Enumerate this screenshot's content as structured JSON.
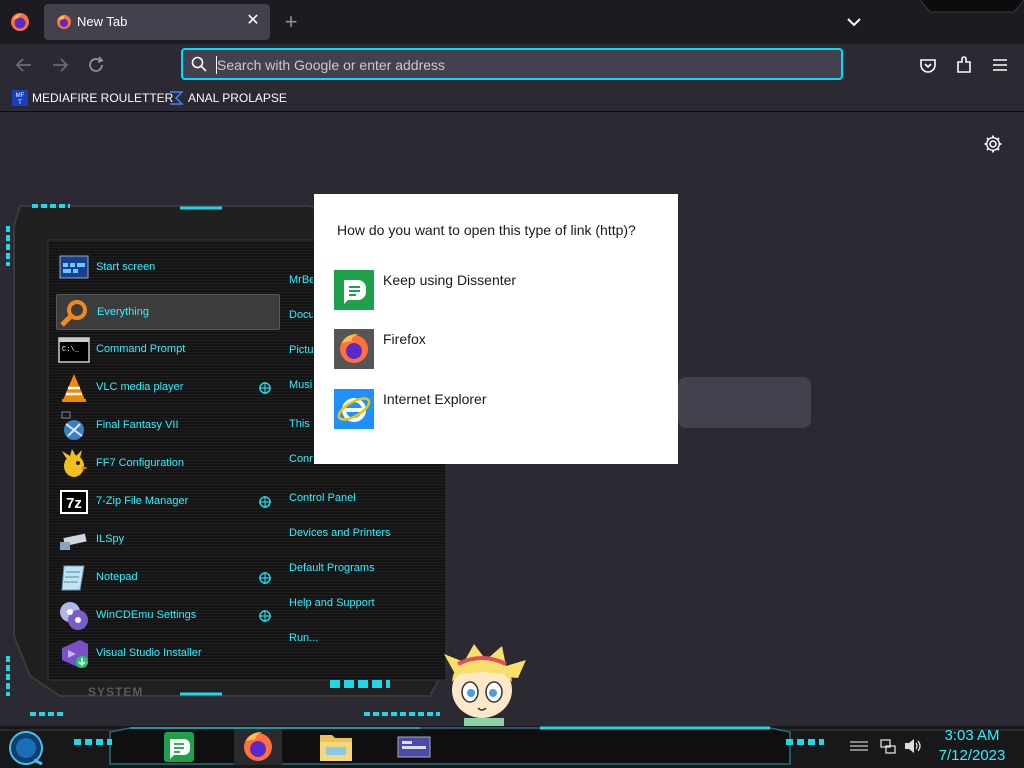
{
  "browser": {
    "tab": {
      "title": "New Tab",
      "close_glyph": "✕"
    },
    "new_tab_glyph": "+",
    "urlbar": {
      "placeholder": "Search with Google or enter address",
      "value": ""
    },
    "bookmarks": [
      {
        "label": "MEDIAFIRE ROULETTER",
        "icon": "mediafire-icon"
      },
      {
        "label": "ANAL PROLAPSE",
        "icon": "sigma-icon"
      }
    ]
  },
  "dialog": {
    "title": "How do you want to open this type of link (http)?",
    "options": [
      {
        "label": "Keep using Dissenter",
        "icon": "dissenter-icon",
        "color": "#1fa04a"
      },
      {
        "label": "Firefox",
        "icon": "firefox-icon",
        "color": "#ff7139"
      },
      {
        "label": "Internet Explorer",
        "icon": "internet-explorer-icon",
        "color": "#1e90ff"
      }
    ]
  },
  "start_menu": {
    "left_items": [
      {
        "label": "Start screen",
        "icon": "start-screen-icon"
      },
      {
        "label": "Everything",
        "icon": "everything-search-icon"
      },
      {
        "label": "Command Prompt",
        "icon": "command-prompt-icon"
      },
      {
        "label": "VLC media player",
        "icon": "vlc-icon"
      },
      {
        "label": "Final Fantasy VII",
        "icon": "final-fantasy-icon"
      },
      {
        "label": "FF7 Configuration",
        "icon": "chocobo-icon"
      },
      {
        "label": "7-Zip File Manager",
        "icon": "7zip-icon"
      },
      {
        "label": "ILSpy",
        "icon": "ilspy-icon"
      },
      {
        "label": "Notepad",
        "icon": "notepad-icon"
      },
      {
        "label": "WinCDEmu Settings",
        "icon": "wincdemu-icon"
      },
      {
        "label": "Visual Studio Installer",
        "icon": "visual-studio-installer-icon"
      }
    ],
    "right_items": [
      "MrBe",
      "Docu",
      "Pictu",
      "Musi",
      "This",
      "Conr",
      "Control Panel",
      "Devices and Printers",
      "Default Programs",
      "Help and Support",
      "Run..."
    ],
    "system_label": "SYSTEM"
  },
  "taskbar": {
    "time": "3:03 AM",
    "date": "7/12/2023",
    "apps": [
      "dissenter-icon",
      "firefox-icon",
      "file-explorer-icon",
      "window-switcher-icon"
    ]
  },
  "colors": {
    "accent": "#00ddff",
    "neon": "#2ff0ff",
    "chrome_dark": "#1c1b22",
    "chrome": "#2b2a33",
    "tab_active": "#42414d"
  }
}
